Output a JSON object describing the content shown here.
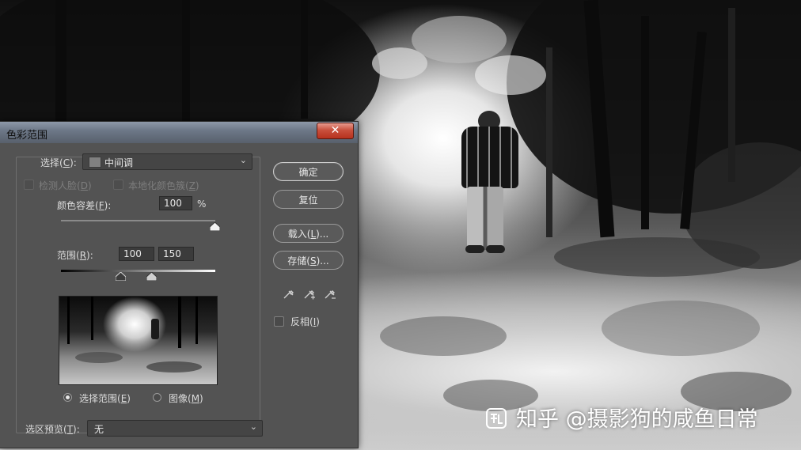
{
  "watermark": "知乎 @摄影狗的咸鱼日常",
  "dialog": {
    "title": "色彩范围",
    "close_icon": "close-icon",
    "select_label": "选择(",
    "select_key": "C",
    "select_label_end": "):",
    "select_value": "中间调",
    "detect_faces_label": "检测人脸(",
    "detect_faces_key": "D",
    "detect_faces_end": ")",
    "localized_label": "本地化颜色簇(",
    "localized_key": "Z",
    "localized_end": ")",
    "fuzziness_label": "颜色容差(",
    "fuzziness_key": "F",
    "fuzziness_end": "):",
    "fuzziness_value": "100",
    "fuzziness_unit": "%",
    "range_label": "范围(",
    "range_key": "R",
    "range_end": "):",
    "range_low": "100",
    "range_high": "150",
    "radio_selection_label": "选择范围(",
    "radio_selection_key": "E",
    "radio_selection_end": ")",
    "radio_image_label": "图像(",
    "radio_image_key": "M",
    "radio_image_end": ")",
    "radio_selected": "selection",
    "preview_label": "选区预览(",
    "preview_key": "T",
    "preview_end": "):",
    "preview_value": "无",
    "buttons": {
      "ok": "确定",
      "reset": "复位",
      "load": "载入(",
      "load_key": "L",
      "load_end": ")...",
      "save": "存储(",
      "save_key": "S",
      "save_end": ")...",
      "invert": "反相(",
      "invert_key": "I",
      "invert_end": ")"
    },
    "eyedroppers": [
      "eyedropper-icon",
      "eyedropper-plus-icon",
      "eyedropper-minus-icon"
    ],
    "fuzziness_level_percent": 100,
    "range_low_level": 100,
    "range_high_level": 150
  },
  "colors": {
    "dialog_bg": "#535353",
    "titlebar": "#6d7888",
    "close_red": "#c9503d"
  }
}
